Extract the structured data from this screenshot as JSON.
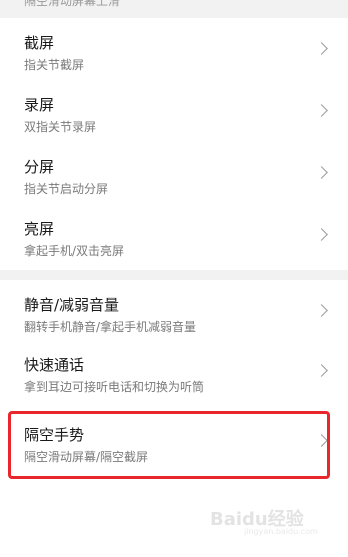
{
  "top_cut_text": "隔空滑动屏幕上滑",
  "groups": [
    {
      "items": [
        {
          "title": "截屏",
          "subtitle": "指关节截屏"
        },
        {
          "title": "录屏",
          "subtitle": "双指关节录屏"
        },
        {
          "title": "分屏",
          "subtitle": "指关节启动分屏"
        },
        {
          "title": "亮屏",
          "subtitle": "拿起手机/双击亮屏"
        }
      ]
    },
    {
      "items": [
        {
          "title": "静音/减弱音量",
          "subtitle": "翻转手机静音/拿起手机减弱音量"
        },
        {
          "title": "快速通话",
          "subtitle": "拿到耳边可接听电话和切换为听筒"
        }
      ]
    },
    {
      "items": [
        {
          "title": "隔空手势",
          "subtitle": "隔空滑动屏幕/隔空截屏"
        }
      ]
    }
  ],
  "highlight_color": "#e8262b",
  "background_gray": "#f2f2f2",
  "watermark": {
    "main": "Baidu经验",
    "sub": "jingyan.baidu.com"
  }
}
